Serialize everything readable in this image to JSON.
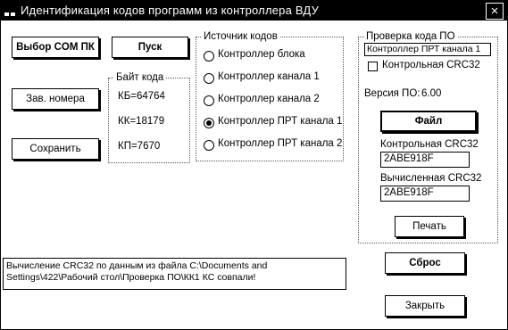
{
  "window": {
    "title": "Идентификация кодов программ из контроллера ВДУ",
    "close_glyph": "×"
  },
  "buttons": {
    "com_port": "Выбор COM ПК",
    "start": "Пуск",
    "serial": "Зав. номера",
    "save": "Сохранить",
    "file": "Файл",
    "print": "Печать",
    "reset": "Сброс",
    "close": "Закрыть"
  },
  "bytes": {
    "title": "Байт кода",
    "kb": "КБ=64764",
    "kk": "КК=18179",
    "kp": "КП=7670"
  },
  "source": {
    "title": "Источник кодов",
    "options": [
      "Контроллер блока",
      "Контроллер канала 1",
      "Контроллер канала 2",
      "Контроллер ПРТ канала 1",
      "Контроллер ПРТ канала 2"
    ],
    "selected_index": 3
  },
  "check": {
    "title": "Проверка кода ПО",
    "selected_source": "Контроллер ПРТ канала 1",
    "crc_checkbox_label": "Контрольная CRC32",
    "crc_checked": false,
    "version_label": "Версия ПО:",
    "version_value": "6.00",
    "control_crc_label": "Контрольная CRC32",
    "control_crc_value": "2ABE918F",
    "computed_crc_label": "Вычисленная CRC32",
    "computed_crc_value": "2ABE918F"
  },
  "status": {
    "message": "Вычисление CRC32 по данным из файла C:\\Documents and Settings\\422\\Рабочий стол\\Проверка ПО\\КК1    КС совпали!"
  }
}
